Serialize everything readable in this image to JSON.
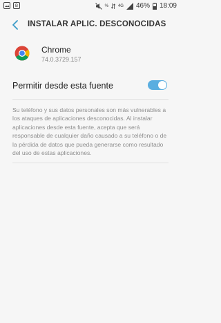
{
  "status_bar": {
    "left_icons": [
      "image-icon",
      "b-icon"
    ],
    "b_glyph": "B",
    "battery": "46%",
    "time": "18:09",
    "signal_small": "%",
    "net_small": "4G"
  },
  "header": {
    "title": "INSTALAR APLIC. DESCONOCIDAS",
    "back_icon": "chevron-left-icon"
  },
  "app": {
    "name": "Chrome",
    "version": "74.0.3729.157",
    "icon": "chrome-icon"
  },
  "setting": {
    "label": "Permitir desde esta fuente",
    "enabled": true,
    "accent": "#5aaee0"
  },
  "description": "Su teléfono y sus datos personales son más vulnerables a los ataques de aplicaciones desconocidas. Al instalar aplicaciones desde esta fuente, acepta que será responsable de cualquier daño causado a su teléfono o de la pérdida de datos que pueda generarse como resultado del uso de estas aplicaciones."
}
